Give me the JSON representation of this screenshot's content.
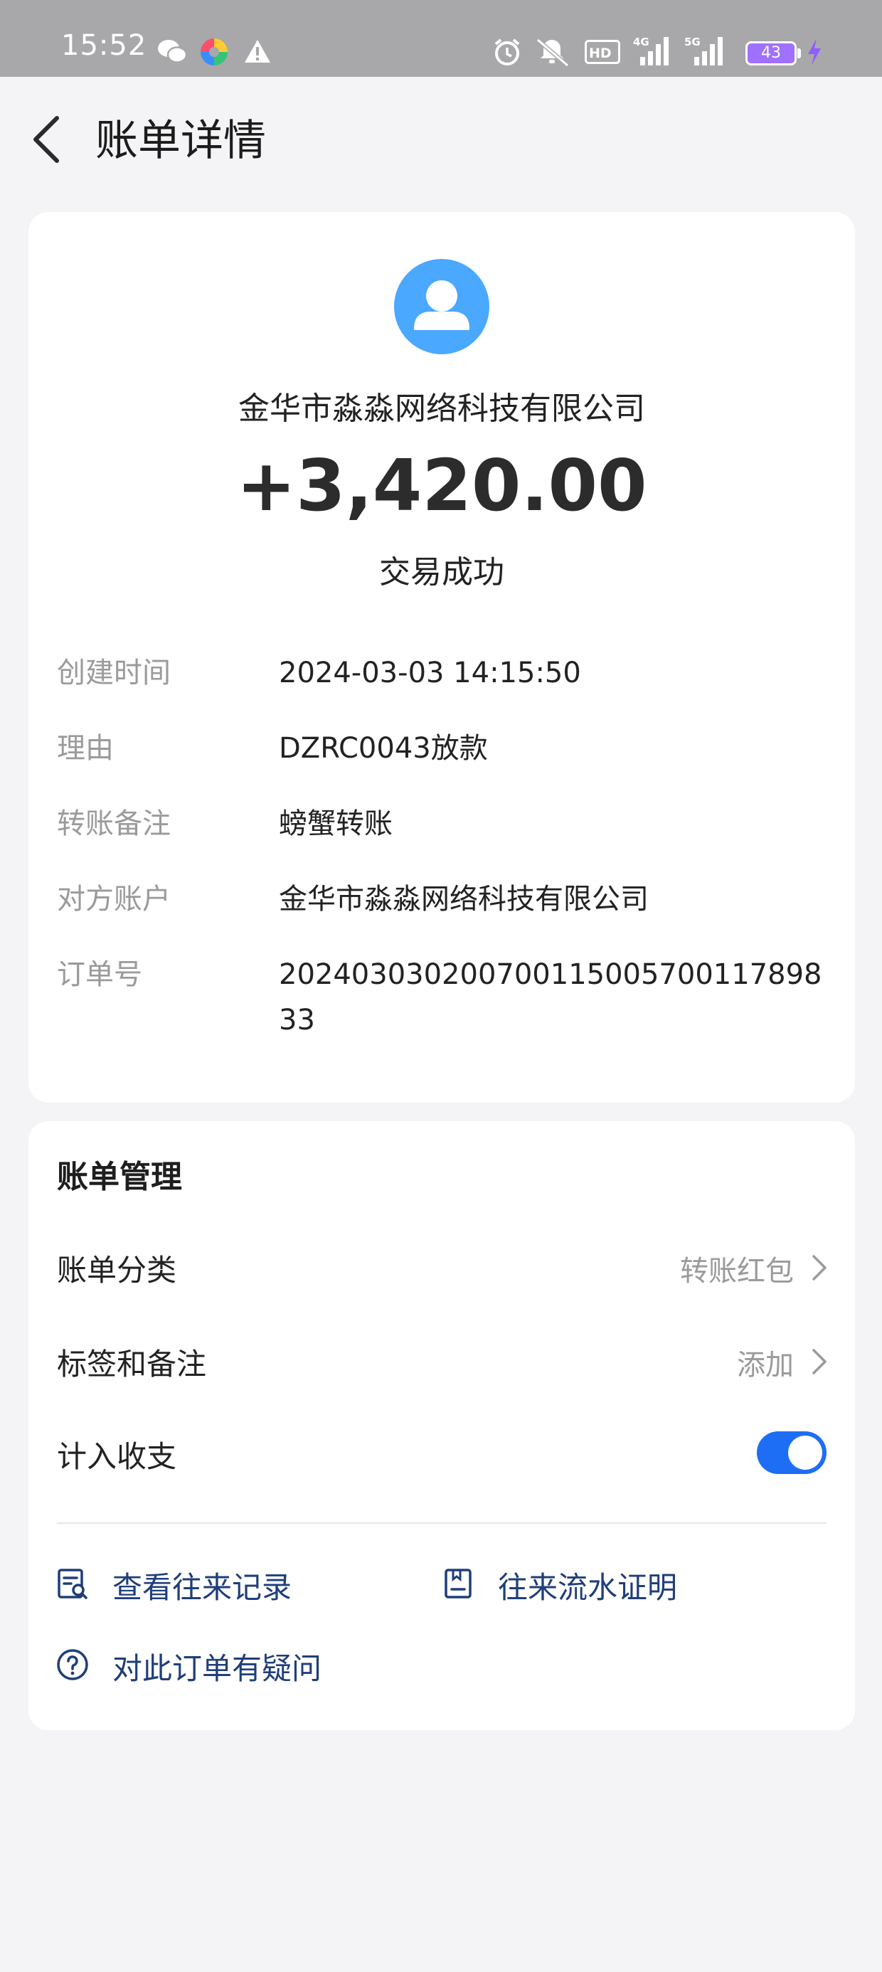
{
  "status_bar": {
    "time": "15:52",
    "battery": "43",
    "network_4g": "4G",
    "network_5g": "5G",
    "hd": "HD"
  },
  "header": {
    "title": "账单详情"
  },
  "transaction": {
    "payee_name": "金华市淼淼网络科技有限公司",
    "amount": "+3,420.00",
    "status": "交易成功",
    "fields": [
      {
        "label": "创建时间",
        "value": "2024-03-03 14:15:50"
      },
      {
        "label": "理由",
        "value": "DZRC0043放款"
      },
      {
        "label": "转账备注",
        "value": "螃蟹转账"
      },
      {
        "label": "对方账户",
        "value": "金华市淼淼网络科技有限公司"
      },
      {
        "label": "订单号",
        "value": "202403030200700115005700117898 33"
      }
    ]
  },
  "management": {
    "title": "账单管理",
    "category_label": "账单分类",
    "category_value": "转账红包",
    "tag_label": "标签和备注",
    "tag_value": "添加",
    "include_label": "计入收支",
    "include_on": true,
    "links": {
      "records": "查看往来记录",
      "statement": "往来流水证明",
      "question": "对此订单有疑问"
    }
  },
  "colors": {
    "accent": "#1d6ef5",
    "link": "#1f3e7a",
    "avatar": "#4aa8ff",
    "status_bar": "#a8a8aa"
  }
}
